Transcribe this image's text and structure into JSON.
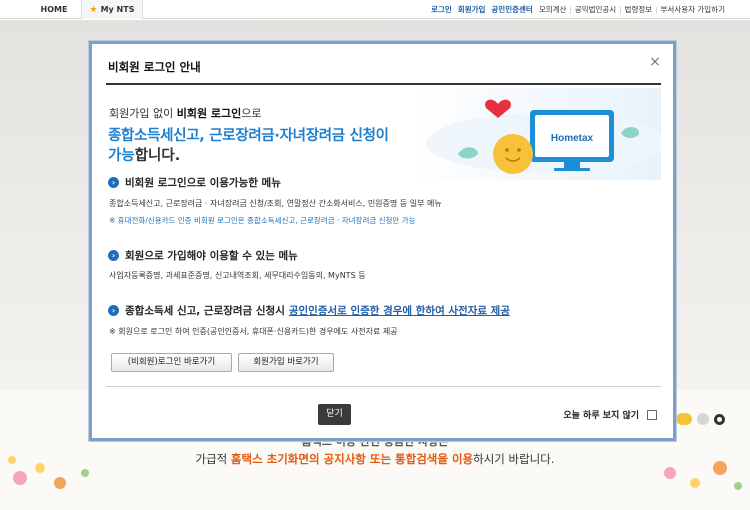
{
  "topbar": {
    "home": "HOME",
    "mynts": "My NTS",
    "links": [
      "로그인",
      "회원가입",
      "공인인증센터",
      "모의계산",
      "공익법인공시",
      "법령정보",
      "부서사용자 가입하기"
    ]
  },
  "background": {
    "line1": "홈택스 이용 관련 궁금한 사항은",
    "line2_pre": "가급적 ",
    "line2_hl": "홈택스 초기화면의 공지사항 또는 통합검색을 이용",
    "line2_post": "하시기 바랍니다."
  },
  "modal": {
    "title": "비회원 로그인 안내",
    "close_icon": "×",
    "intro1_pre": "회원가입 없이 ",
    "intro1_bold": "비회원 로그인",
    "intro1_post": "으로",
    "intro2": "종합소득세신고, 근로장려금·자녀장려금 신청이",
    "intro3_blue": "가능",
    "intro3_dark": "합니다.",
    "logo_text": "Hometax",
    "sections": [
      {
        "heading": "비회원 로그인으로 이용가능한 메뉴",
        "text": "종합소득세신고, 근로장려금 · 자녀장려금 신청/조회, 연말정산 간소화서비스, 민원증명 등 일부 메뉴",
        "note": "※ 휴대전화/신용카드 인증 비회원 로그인은 종합소득세신고, 근로장려금 · 자녀장려금 신청만 가능"
      },
      {
        "heading": "회원으로 가입해야 이용할 수 있는 메뉴",
        "text": "사업자등록증명, 과세표준증명, 신고내역조회, 세무대리수임동의, MyNTS 등"
      },
      {
        "heading": "종합소득세 신고, 근로장려금 신청시",
        "heading_link": "공인인증서로 인증한 경우에 한하여 사전자료 제공",
        "text": "※ 회원으로 로그인 하여 인증(공인인증서, 휴대폰·신용카드)한 경우에도 사전자료 제공"
      }
    ],
    "btn_nonmember": "(비회원)로그인 바로가기",
    "btn_signup": "회원가입 바로가기",
    "btn_close": "닫기",
    "dont_show": "오늘 하루 보지 않기"
  }
}
